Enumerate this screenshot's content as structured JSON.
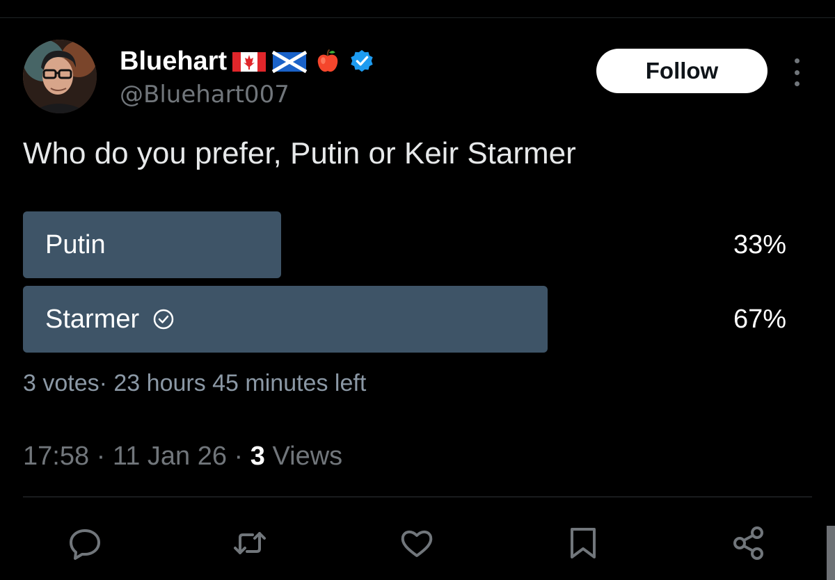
{
  "author": {
    "display_name": "Bluehart",
    "handle": "@Bluehart007",
    "badges": [
      "canada-flag-icon",
      "scotland-flag-icon",
      "red-apple-icon",
      "verified-icon"
    ]
  },
  "follow_label": "Follow",
  "tweet_text": "Who do you prefer, Putin or Keir Starmer",
  "poll": {
    "options": [
      {
        "label": "Putin",
        "percent_label": "33%",
        "percent": 33,
        "selected": false
      },
      {
        "label": "Starmer",
        "percent_label": "67%",
        "percent": 67,
        "selected": true
      }
    ],
    "meta": "3 votes· 23 hours 45 minutes left"
  },
  "footer": {
    "time": "17:58",
    "sep1": " · ",
    "date": "11 Jan 26",
    "sep2": " · ",
    "views_count": "3",
    "views_label": " Views"
  },
  "actions": [
    "reply-icon",
    "retweet-icon",
    "like-icon",
    "bookmark-icon",
    "share-icon"
  ],
  "colors": {
    "background": "#000000",
    "poll_fill": "#3e5467",
    "verified": "#1d9bf0",
    "muted_text": "#71767b"
  }
}
